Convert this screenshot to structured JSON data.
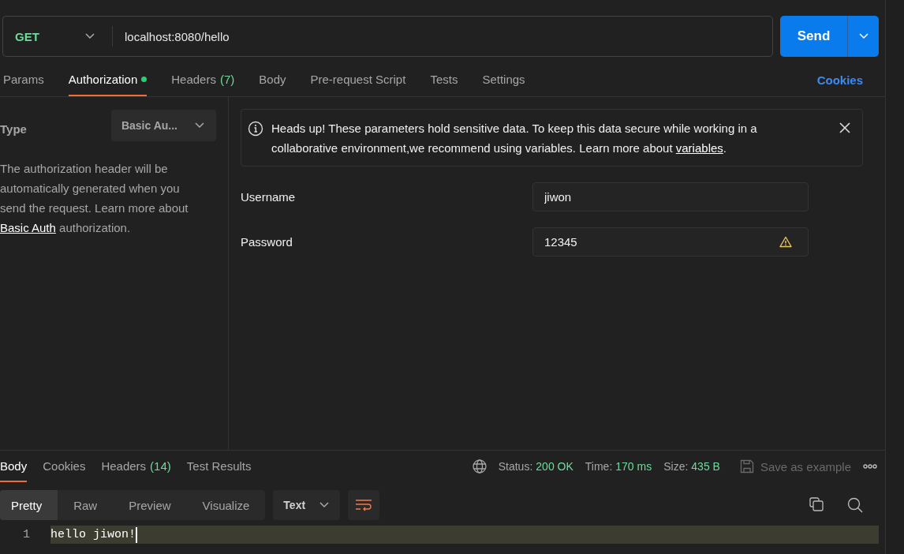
{
  "request": {
    "method": "GET",
    "url": "localhost:8080/hello",
    "send_label": "Send"
  },
  "request_tabs": [
    {
      "label": "Params",
      "selected": false,
      "modified": false
    },
    {
      "label": "Authorization",
      "selected": true,
      "modified": true
    },
    {
      "label": "Headers",
      "count": "(7)",
      "selected": false,
      "modified": false
    },
    {
      "label": "Body",
      "selected": false,
      "modified": false
    },
    {
      "label": "Pre-request Script",
      "selected": false,
      "modified": false
    },
    {
      "label": "Tests",
      "selected": false,
      "modified": false
    },
    {
      "label": "Settings",
      "selected": false,
      "modified": false
    }
  ],
  "cookies_link": "Cookies",
  "auth": {
    "type_label": "Type",
    "type_value": "Basic Au...",
    "description": "The authorization header will be automatically generated when you send the request. Learn more about ",
    "description_link": "Basic Auth",
    "description_end": " authorization."
  },
  "notice": {
    "text": "Heads up! These parameters hold sensitive data. To keep this data secure while working in a collaborative environment,we recommend using variables. Learn more about ",
    "link": "variables",
    "text_end": "."
  },
  "fields": [
    {
      "label": "Username",
      "value": "jiwon",
      "warning": false
    },
    {
      "label": "Password",
      "value": "12345",
      "warning": true
    }
  ],
  "response_tabs": [
    {
      "label": "Body",
      "selected": true
    },
    {
      "label": "Cookies",
      "selected": false
    },
    {
      "label": "Headers",
      "count": "(14)",
      "selected": false
    },
    {
      "label": "Test Results",
      "selected": false
    }
  ],
  "response_stats": [
    {
      "label": "Status:",
      "value": "200 OK"
    },
    {
      "label": "Time:",
      "value": "170 ms"
    },
    {
      "label": "Size:",
      "value": "435 B"
    }
  ],
  "save_label": "Save as example",
  "view_modes": [
    {
      "label": "Pretty",
      "selected": true
    },
    {
      "label": "Raw",
      "selected": false
    },
    {
      "label": "Preview",
      "selected": false
    },
    {
      "label": "Visualize",
      "selected": false
    }
  ],
  "format": "Text",
  "lines": [
    {
      "number": "1",
      "text": "hello jiwon!"
    }
  ]
}
